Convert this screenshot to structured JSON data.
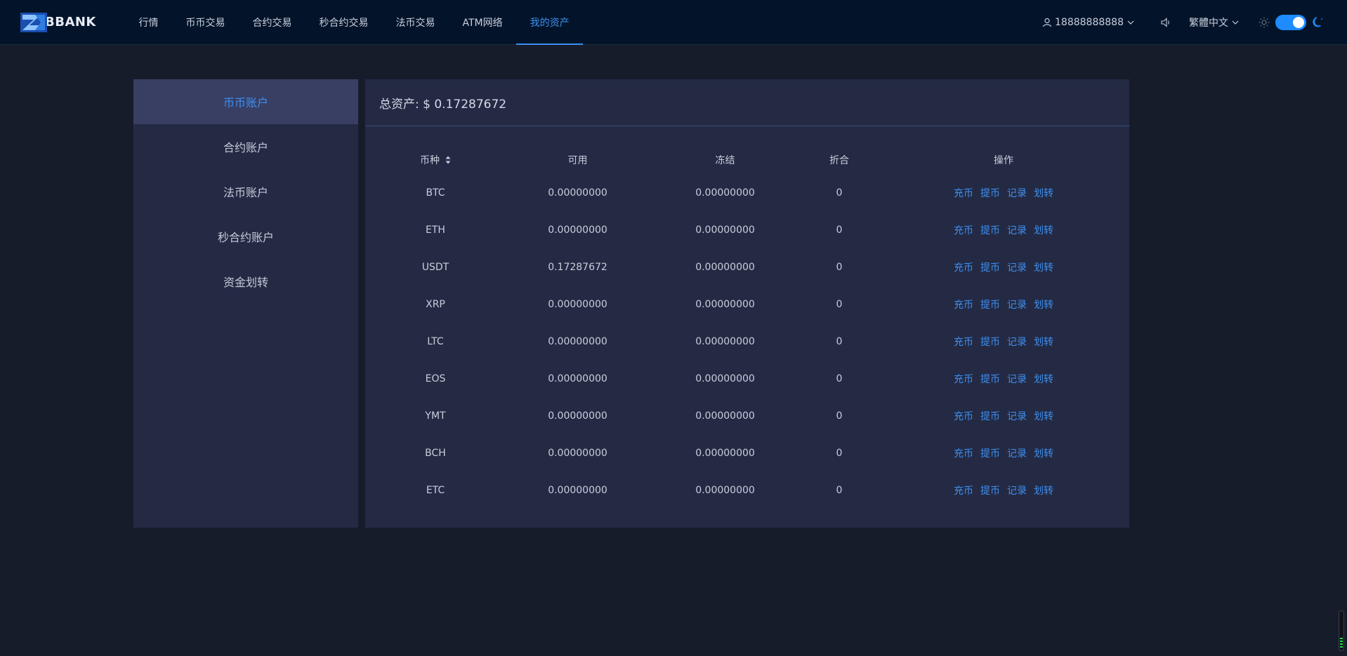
{
  "header": {
    "logo_text": "BBANK",
    "nav": [
      {
        "label": "行情"
      },
      {
        "label": "币币交易"
      },
      {
        "label": "合约交易"
      },
      {
        "label": "秒合约交易"
      },
      {
        "label": "法币交易"
      },
      {
        "label": "ATM网络"
      },
      {
        "label": "我的资产",
        "active": true
      }
    ],
    "user_phone": "18888888888",
    "language": "繁體中文",
    "theme_toggle_on": true,
    "accent_color": "#3d8ff0"
  },
  "sidebar": {
    "items": [
      {
        "label": "币币账户",
        "active": true
      },
      {
        "label": "合约账户"
      },
      {
        "label": "法币账户"
      },
      {
        "label": "秒合约账户"
      },
      {
        "label": "资金划转"
      }
    ]
  },
  "panel": {
    "total_label": "总资产: $ 0.17287672",
    "columns": [
      "币种",
      "可用",
      "冻结",
      "折合",
      "操作"
    ],
    "actions": [
      "充币",
      "提币",
      "记录",
      "划转"
    ],
    "rows": [
      {
        "coin": "BTC",
        "available": "0.00000000",
        "frozen": "0.00000000",
        "converted": "0"
      },
      {
        "coin": "ETH",
        "available": "0.00000000",
        "frozen": "0.00000000",
        "converted": "0"
      },
      {
        "coin": "USDT",
        "available": "0.17287672",
        "frozen": "0.00000000",
        "converted": "0"
      },
      {
        "coin": "XRP",
        "available": "0.00000000",
        "frozen": "0.00000000",
        "converted": "0"
      },
      {
        "coin": "LTC",
        "available": "0.00000000",
        "frozen": "0.00000000",
        "converted": "0"
      },
      {
        "coin": "EOS",
        "available": "0.00000000",
        "frozen": "0.00000000",
        "converted": "0"
      },
      {
        "coin": "YMT",
        "available": "0.00000000",
        "frozen": "0.00000000",
        "converted": "0"
      },
      {
        "coin": "BCH",
        "available": "0.00000000",
        "frozen": "0.00000000",
        "converted": "0"
      },
      {
        "coin": "ETC",
        "available": "0.00000000",
        "frozen": "0.00000000",
        "converted": "0"
      }
    ]
  }
}
